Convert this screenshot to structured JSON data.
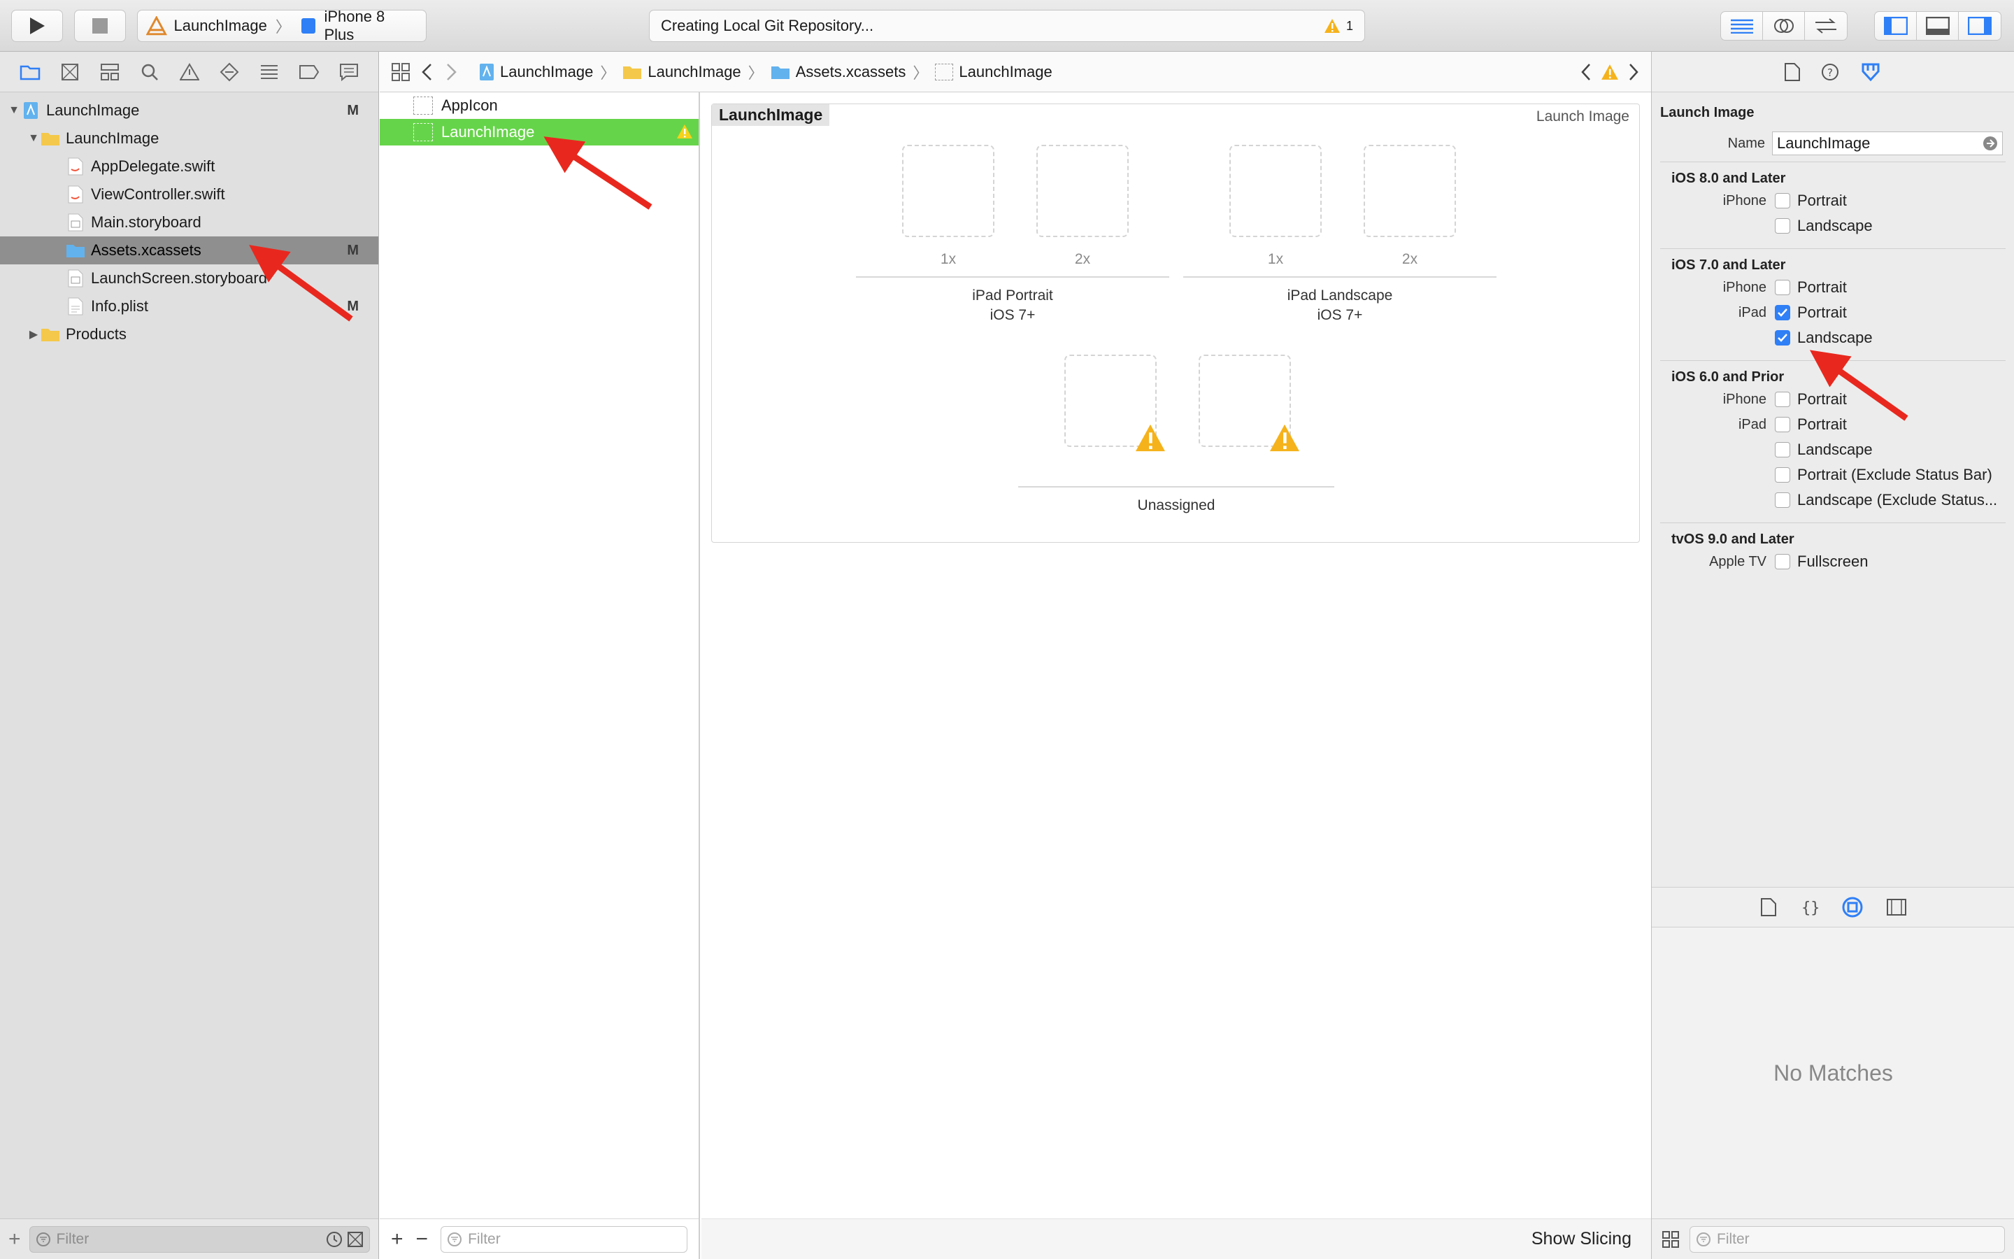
{
  "toolbar": {
    "scheme_app": "LaunchImage",
    "scheme_device": "iPhone 8 Plus",
    "status_text": "Creating Local Git Repository...",
    "warning_count": "1"
  },
  "navigator": {
    "items": [
      {
        "label": "LaunchImage",
        "badge": "M"
      },
      {
        "label": "LaunchImage",
        "badge": ""
      },
      {
        "label": "AppDelegate.swift",
        "badge": ""
      },
      {
        "label": "ViewController.swift",
        "badge": ""
      },
      {
        "label": "Main.storyboard",
        "badge": ""
      },
      {
        "label": "Assets.xcassets",
        "badge": "M"
      },
      {
        "label": "LaunchScreen.storyboard",
        "badge": ""
      },
      {
        "label": "Info.plist",
        "badge": "M"
      },
      {
        "label": "Products",
        "badge": ""
      }
    ],
    "filter_placeholder": "Filter"
  },
  "jumpbar": {
    "crumbs": [
      "LaunchImage",
      "LaunchImage",
      "Assets.xcassets",
      "LaunchImage"
    ]
  },
  "assets": {
    "items": [
      "AppIcon",
      "LaunchImage"
    ],
    "filter_placeholder": "Filter"
  },
  "canvas": {
    "set_name": "LaunchImage",
    "set_kind": "Launch Image",
    "scale_1x": "1x",
    "scale_2x": "2x",
    "group_ipad_portrait": "iPad Portrait",
    "group_ipad_landscape": "iPad Landscape",
    "group_ios7": "iOS 7+",
    "group_unassigned": "Unassigned",
    "show_slicing": "Show Slicing"
  },
  "inspector": {
    "title": "Launch Image",
    "name_label": "Name",
    "name_value": "LaunchImage",
    "sections": [
      {
        "title": "iOS 8.0 and Later",
        "options": [
          {
            "device": "iPhone",
            "label": "Portrait",
            "checked": false
          },
          {
            "device": "",
            "label": "Landscape",
            "checked": false
          }
        ]
      },
      {
        "title": "iOS 7.0 and Later",
        "options": [
          {
            "device": "iPhone",
            "label": "Portrait",
            "checked": false
          },
          {
            "device": "iPad",
            "label": "Portrait",
            "checked": true
          },
          {
            "device": "",
            "label": "Landscape",
            "checked": true
          }
        ]
      },
      {
        "title": "iOS 6.0 and Prior",
        "options": [
          {
            "device": "iPhone",
            "label": "Portrait",
            "checked": false
          },
          {
            "device": "iPad",
            "label": "Portrait",
            "checked": false
          },
          {
            "device": "",
            "label": "Landscape",
            "checked": false
          },
          {
            "device": "",
            "label": "Portrait (Exclude Status Bar)",
            "checked": false
          },
          {
            "device": "",
            "label": "Landscape (Exclude Status...",
            "checked": false
          }
        ]
      },
      {
        "title": "tvOS 9.0 and Later",
        "options": [
          {
            "device": "Apple TV",
            "label": "Fullscreen",
            "checked": false
          }
        ]
      }
    ],
    "library_empty": "No Matches",
    "filter_placeholder": "Filter"
  },
  "colors": {
    "selection_green": "#66d44a",
    "checkbox_blue": "#2f7ff6",
    "annotation_red": "#e8281e",
    "folder_yellow": "#f4c84a",
    "asset_blue": "#62b2ee"
  }
}
